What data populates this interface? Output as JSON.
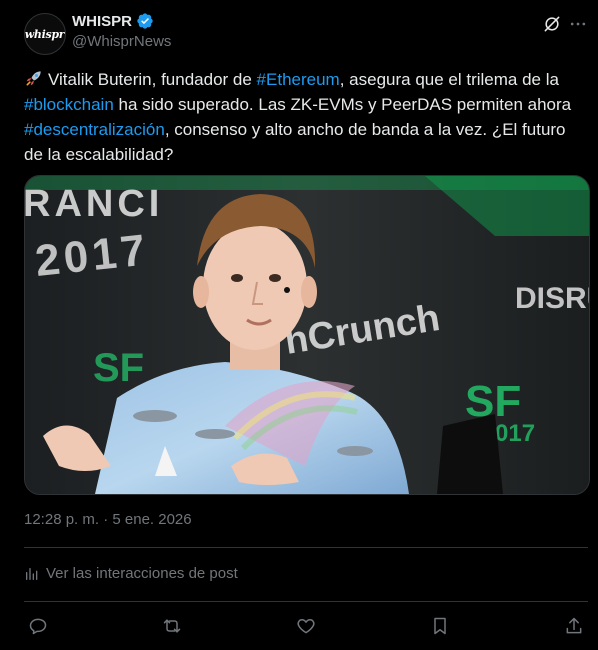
{
  "author": {
    "display_name": "WHISPR",
    "handle": "@WhisprNews",
    "avatar_text": "whispr",
    "verified": true
  },
  "header_icons": [
    "grok-icon",
    "more-icon"
  ],
  "tweet": {
    "parts": [
      {
        "text": "Vitalik Buterin, fundador de ",
        "type": "text"
      },
      {
        "text": "#Ethereum",
        "type": "hashtag"
      },
      {
        "text": ", asegura que el trilema de la ",
        "type": "text"
      },
      {
        "text": "#blockchain",
        "type": "hashtag"
      },
      {
        "text": " ha sido superado. Las ZK-EVMs y PeerDAS permiten ahora ",
        "type": "text"
      },
      {
        "text": "#descentralización",
        "type": "hashtag"
      },
      {
        "text": ", consenso y alto ancho de banda a la vez. ¿El futuro de la escalabilidad?",
        "type": "text"
      }
    ],
    "leading_emoji": "rocket-icon"
  },
  "media": {
    "background_text": {
      "rancisco": "RANCI",
      "year": "2017",
      "brand": "hCrunch",
      "disrupt": "DISRU",
      "sf_left": "SF",
      "sf_right": "SF",
      "year_right": "017"
    }
  },
  "meta": {
    "timestamp": "12:28 p. m. · 5 ene. 2026",
    "interactions_label": "Ver las interacciones de post"
  },
  "actions": [
    "reply-icon",
    "repost-icon",
    "like-icon",
    "bookmark-icon",
    "share-icon"
  ],
  "colors": {
    "accent": "#1d9bf0",
    "secondary_text": "#71767b",
    "primary_text": "#e7e9ea",
    "divider": "#2f3336",
    "background": "#000000"
  }
}
